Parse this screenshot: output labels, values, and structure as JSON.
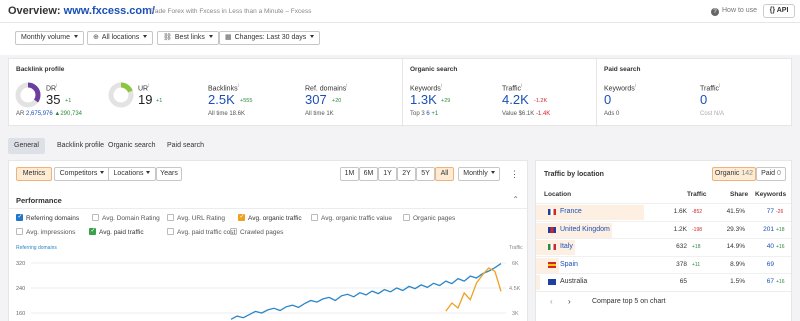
{
  "header": {
    "title_prefix": "Overview:",
    "title_domain": "www.fxcess.com/",
    "subtitle": "Trade Forex with Fxcess in Less than a Minute – Fxcess",
    "howto": "How to use",
    "api": "API"
  },
  "filters": {
    "volume": "Monthly volume",
    "locations": "All locations",
    "links": "Best links",
    "changes": "Changes: Last 30 days"
  },
  "backlink_profile": {
    "heading": "Backlink profile",
    "dr_label": "DR",
    "dr_value": "35",
    "dr_delta": "+1",
    "ar_text": "AR",
    "ar_value": "2,675,976",
    "ar_delta": "▲290,734",
    "ur_label": "UR",
    "ur_value": "19",
    "ur_delta": "+1",
    "backlinks_label": "Backlinks",
    "backlinks_value": "2.5K",
    "backlinks_delta": "+555",
    "backlinks_alltime": "All time  18.6K",
    "refdomains_label": "Ref. domains",
    "refdomains_value": "307",
    "refdomains_delta": "+20",
    "refdomains_alltime": "All time  1K"
  },
  "organic_search": {
    "heading": "Organic search",
    "keywords_label": "Keywords",
    "keywords_value": "1.3K",
    "keywords_delta": "+29",
    "top3_label": "Top 3",
    "top3_value": "6",
    "top3_delta": "+1",
    "traffic_label": "Traffic",
    "traffic_value": "4.2K",
    "traffic_delta": "-1.2K",
    "value_label": "Value",
    "value_value": "$6.1K",
    "value_delta": "-1.4K"
  },
  "paid_search": {
    "heading": "Paid search",
    "keywords_label": "Keywords",
    "keywords_value": "0",
    "ads_text": "Ads  0",
    "traffic_label": "Traffic",
    "traffic_value": "0",
    "cost_text": "Cost  N/A"
  },
  "tabs": [
    "General",
    "Backlink profile",
    "Organic search",
    "Paid search"
  ],
  "toolbar": {
    "metrics": "Metrics",
    "competitors": "Competitors",
    "locations": "Locations",
    "years": "Years",
    "ranges": [
      "1M",
      "6M",
      "1Y",
      "2Y",
      "5Y",
      "All"
    ],
    "interval": "Monthly",
    "more": "⋮"
  },
  "performance": {
    "title": "Performance",
    "checkboxes": [
      {
        "label": "Referring domains",
        "checked": true,
        "color": "#1f78c8"
      },
      {
        "label": "Avg. Domain Rating",
        "checked": false
      },
      {
        "label": "Avg. URL Rating",
        "checked": false
      },
      {
        "label": "Avg. organic traffic",
        "checked": true,
        "color": "#f0a020"
      },
      {
        "label": "Avg. organic traffic value",
        "checked": false
      },
      {
        "label": "Organic pages",
        "checked": false
      },
      {
        "label": "Avg. impressions",
        "checked": false
      },
      {
        "label": "Avg. paid traffic",
        "checked": true,
        "color": "#3aa14a"
      },
      {
        "label": "Avg. paid traffic cost",
        "checked": false
      },
      {
        "label": "Crawled pages",
        "checked": false
      }
    ],
    "left_axis_label": "Referring domains",
    "right_axis_label": "Traffic",
    "left_ticks": [
      "320",
      "240",
      "160"
    ],
    "right_ticks": [
      "6K",
      "4.5K",
      "3K"
    ]
  },
  "chart_data": {
    "type": "line",
    "series": [
      {
        "name": "Referring domains",
        "color": "#2b86c9",
        "values": [
          140,
          150,
          145,
          155,
          165,
          160,
          170,
          175,
          168,
          180,
          185,
          178,
          190,
          200,
          195,
          205,
          210,
          200,
          215,
          220,
          212,
          225,
          218,
          230,
          222,
          235,
          228,
          240,
          232,
          245,
          238,
          250,
          242,
          255,
          248,
          262,
          254,
          270,
          262,
          278,
          272,
          286,
          294,
          305,
          318
        ]
      },
      {
        "name": "Avg. organic traffic",
        "color": "#f0a020",
        "values": [
          null,
          null,
          null,
          null,
          null,
          null,
          null,
          null,
          null,
          null,
          null,
          null,
          null,
          null,
          null,
          null,
          null,
          null,
          null,
          null,
          null,
          null,
          null,
          null,
          null,
          null,
          null,
          null,
          null,
          null,
          null,
          null,
          null,
          null,
          null,
          3100,
          3600,
          3300,
          4200,
          3800,
          4800,
          5300,
          5700,
          5500,
          4300
        ]
      }
    ]
  },
  "traffic_by_location": {
    "title": "Traffic by location",
    "organic_btn": "Organic",
    "organic_count": "142",
    "paid_btn": "Paid",
    "paid_count": "0",
    "headers": {
      "location": "Location",
      "traffic": "Traffic",
      "share": "Share",
      "keywords": "Keywords"
    },
    "rows": [
      {
        "country": "France",
        "traffic": "1.6K",
        "delta": "-852",
        "delta_dir": "down",
        "share": "41.5%",
        "share_num": 41.5,
        "keywords": "77",
        "kw_delta": "-26",
        "kw_dir": "down",
        "link": true
      },
      {
        "country": "United Kingdom",
        "traffic": "1.2K",
        "delta": "-198",
        "delta_dir": "down",
        "share": "29.3%",
        "share_num": 29.3,
        "keywords": "201",
        "kw_delta": "+18",
        "kw_dir": "up",
        "link": true
      },
      {
        "country": "Italy",
        "traffic": "632",
        "delta": "+18",
        "delta_dir": "up",
        "share": "14.9%",
        "share_num": 14.9,
        "keywords": "40",
        "kw_delta": "+16",
        "kw_dir": "up",
        "link": true
      },
      {
        "country": "Spain",
        "traffic": "378",
        "delta": "+11",
        "delta_dir": "up",
        "share": "8.9%",
        "share_num": 8.9,
        "keywords": "69",
        "kw_delta": "",
        "kw_dir": "",
        "link": true
      },
      {
        "country": "Australia",
        "traffic": "65",
        "delta": "",
        "delta_dir": "",
        "share": "1.5%",
        "share_num": 1.5,
        "keywords": "67",
        "kw_delta": "+16",
        "kw_dir": "up",
        "link": false
      }
    ],
    "compare_text": "Compare top 5 on chart"
  }
}
